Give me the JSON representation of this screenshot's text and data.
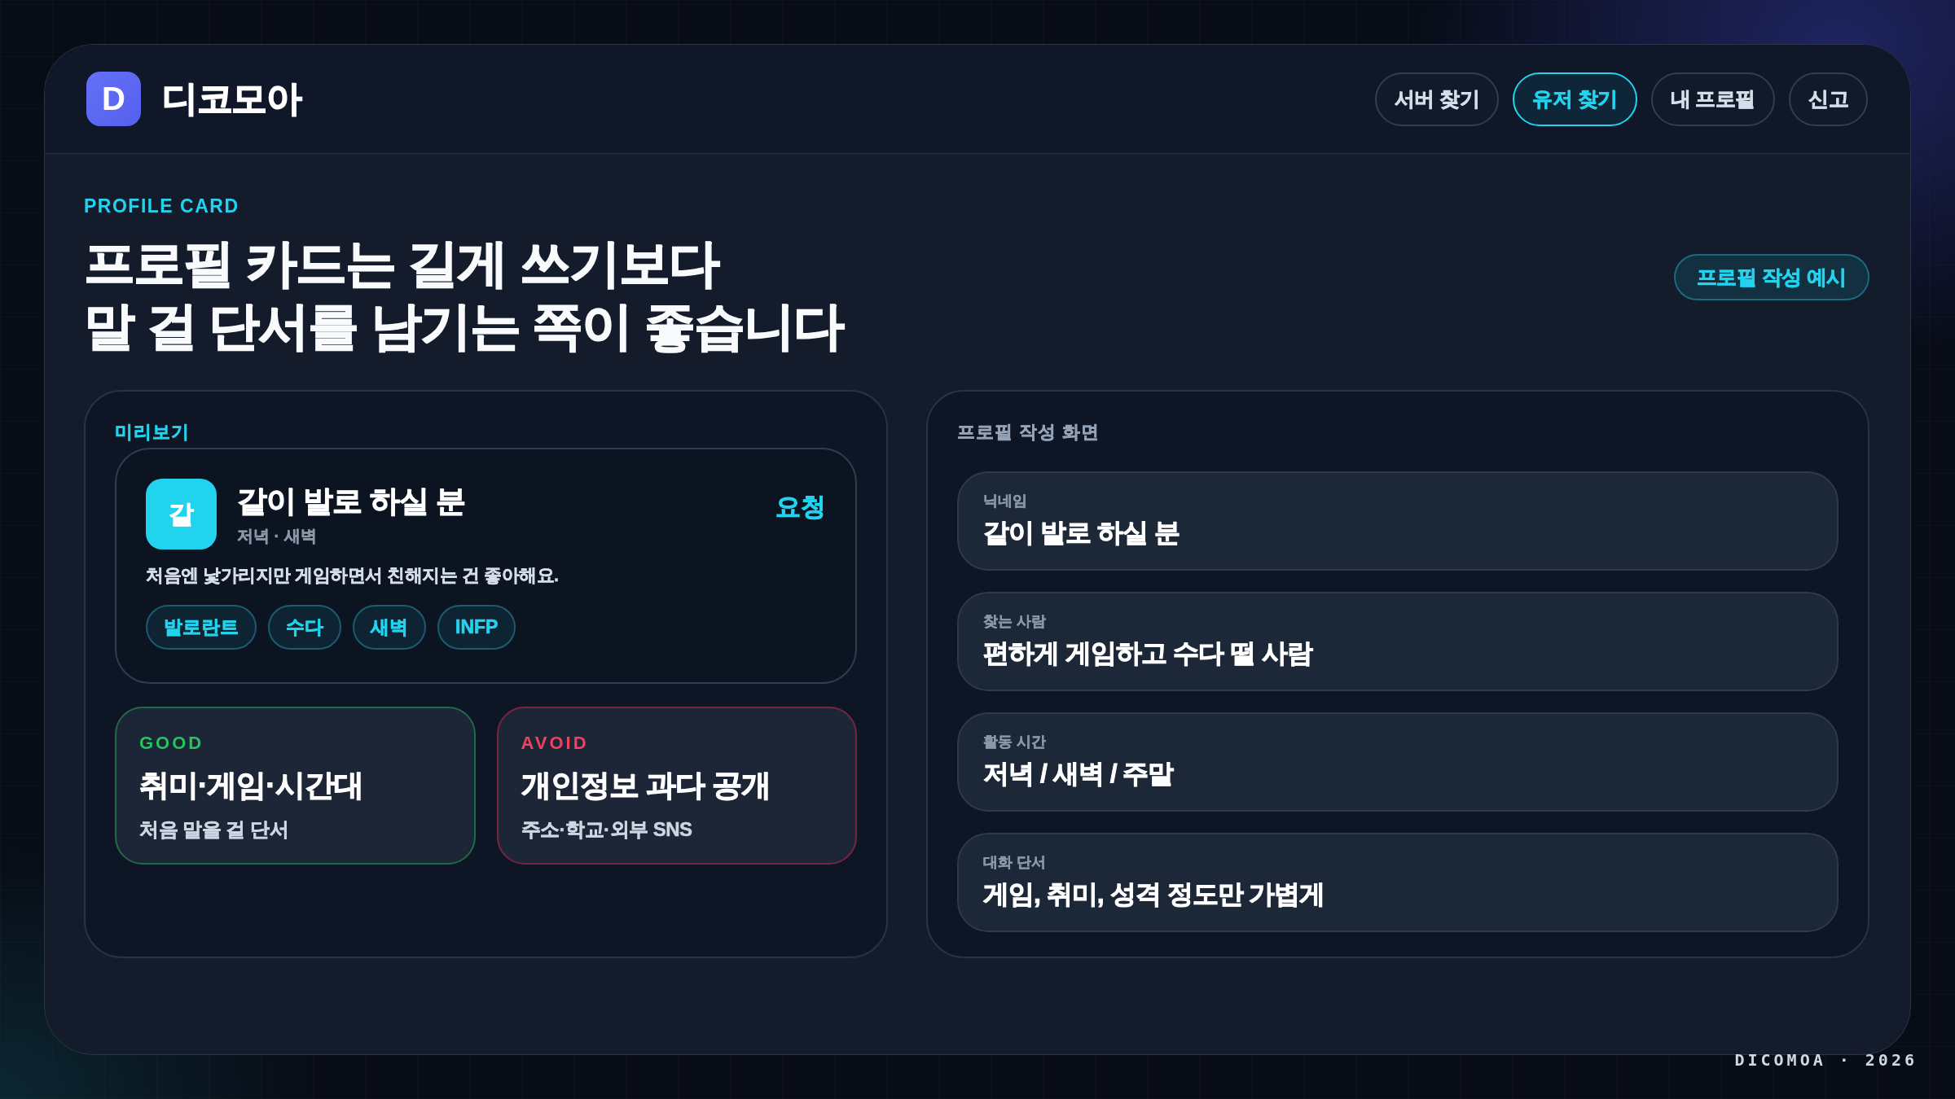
{
  "brand": {
    "logo_letter": "D",
    "name": "디코모아"
  },
  "nav": [
    {
      "label": "서버 찾기",
      "selected": false
    },
    {
      "label": "유저 찾기",
      "selected": true
    },
    {
      "label": "내 프로필",
      "selected": false
    },
    {
      "label": "신고",
      "selected": false
    }
  ],
  "hero": {
    "eyebrow": "PROFILE CARD",
    "headline_lines": [
      "프로필 카드는 길게 쓰기보다",
      "말 걸 단서를 남기는 쪽이 좋습니다"
    ],
    "action": "프로필 작성 예시"
  },
  "preview": {
    "label": "미리보기",
    "card": {
      "avatar_letter": "같",
      "name": "같이 발로 하실 분",
      "times": "저녁 · 새벽",
      "action": "요청",
      "bio": "처음엔 낯가리지만 게임하면서 친해지는 건 좋아해요.",
      "tags": [
        "발로란트",
        "수다",
        "새벽",
        "INFP"
      ]
    },
    "tips": [
      {
        "kind": "good",
        "label": "GOOD",
        "title": "취미·게임·시간대",
        "note": "처음 말을 걸 단서"
      },
      {
        "kind": "avoid",
        "label": "AVOID",
        "title": "개인정보 과다 공개",
        "note": "주소·학교·외부 SNS"
      }
    ]
  },
  "editor": {
    "label": "프로필 작성 화면",
    "fields": [
      {
        "label": "닉네임",
        "value": "같이 발로 하실 분"
      },
      {
        "label": "찾는 사람",
        "value": "편하게 게임하고 수다 떨 사람"
      },
      {
        "label": "활동 시간",
        "value": "저녁 / 새벽 / 주말"
      },
      {
        "label": "대화 단서",
        "value": "게임, 취미, 성격 정도만 가볍게"
      }
    ]
  },
  "footer": "DICOMOA · 2026"
}
